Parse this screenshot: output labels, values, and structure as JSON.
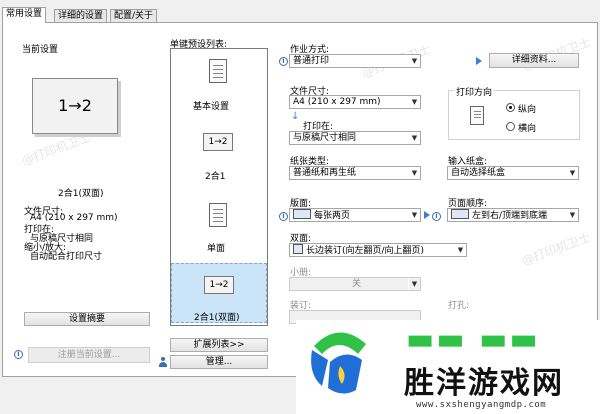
{
  "tabs": [
    {
      "label": "常用设置",
      "active": true
    },
    {
      "label": "详细的设置",
      "active": false
    },
    {
      "label": "配置/关于",
      "active": false
    }
  ],
  "current_settings": {
    "title": "当前设置",
    "preview_text": "1→2",
    "caption": "2合1(双面)",
    "details": [
      "文件尺寸:",
      "A4 (210 x 297 mm)",
      "打印在:",
      "与原稿尺寸相同",
      "缩小/放大:",
      "自动配合打印尺寸"
    ],
    "summary_button": "设置摘要",
    "register_button": "注册当前设置..."
  },
  "presets": {
    "title": "单键预设列表:",
    "items": [
      {
        "label": "基本设置",
        "icon_text": ""
      },
      {
        "label": "2合1",
        "icon_text": "1→2"
      },
      {
        "label": "单面",
        "icon_text": ""
      },
      {
        "label": "2合1(双面)",
        "icon_text": "1→2",
        "selected": true
      }
    ],
    "extend_button": "扩展列表>>",
    "manage_button": "管理..."
  },
  "job": {
    "label": "作业方式:",
    "value": "普通打印",
    "details_button": "详细资料..."
  },
  "paper_size": {
    "label": "文件尺寸:",
    "value": "A4 (210 x 297 mm)"
  },
  "print_on": {
    "label": "打印在:",
    "value": "与原稿尺寸相同"
  },
  "orientation": {
    "title": "打印方向",
    "options": [
      "纵向",
      "横向"
    ],
    "selected": "纵向"
  },
  "media_type": {
    "label": "纸张类型:",
    "value": "普通纸和再生纸"
  },
  "paper_source": {
    "label": "输入纸盒:",
    "value": "自动选择纸盒"
  },
  "layout": {
    "label": "版面:",
    "value": "每张两页"
  },
  "page_order": {
    "label": "页面顺序:",
    "value": "左到右/顶端到底端"
  },
  "duplex": {
    "label": "双面:",
    "value": "长边装订(向左翻页/向上翻页)"
  },
  "booklet": {
    "label": "小册:",
    "value": "关"
  },
  "binding": {
    "label": "装订:"
  },
  "hole_punch": {
    "label": "打孔:"
  },
  "watermark_text": "@打印机卫士",
  "logo": {
    "title": "胜洋游戏网",
    "url": "www.sxshengyangmdp.com",
    "colors": {
      "green": "#2fc247",
      "blue": "#1f6fd6"
    }
  }
}
